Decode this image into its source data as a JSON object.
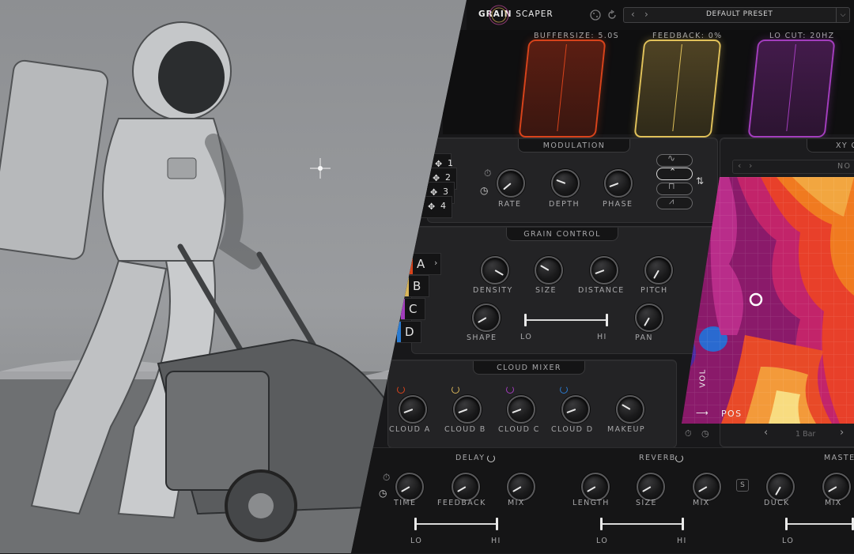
{
  "header": {
    "logo_part1": "GRAIN",
    "logo_part2": "SCAPER",
    "preset": "DEFAULT PRESET"
  },
  "grains": [
    {
      "label": "BUFFERSIZE: 5.0s",
      "color": "#d8431b"
    },
    {
      "label": "FEEDBACK: 0%",
      "color": "#e0c15a"
    },
    {
      "label": "LO CUT: 20hz",
      "color": "#a33dbd"
    }
  ],
  "modulation": {
    "title": "MODULATION",
    "slots": [
      "1",
      "2",
      "3",
      "4"
    ],
    "knobs": [
      "RATE",
      "DEPTH",
      "PHASE"
    ]
  },
  "grain_control": {
    "title": "GRAIN CONTROL",
    "slots": [
      {
        "label": "A",
        "color": "#d8431b"
      },
      {
        "label": "B",
        "color": "#d9b65a"
      },
      {
        "label": "C",
        "color": "#a33dbd"
      },
      {
        "label": "D",
        "color": "#2a7bd1"
      }
    ],
    "knobs_row1": [
      "DENSITY",
      "SIZE",
      "DISTANCE",
      "PITCH"
    ],
    "knobs_row2": [
      "SHAPE",
      "PAN"
    ],
    "range_lo": "LO",
    "range_hi": "HI"
  },
  "xy": {
    "title": "XY C",
    "preset": "NO P",
    "x_label": "POS",
    "y_label": "VOL",
    "sync": "1 Bar"
  },
  "cloud_mixer": {
    "title": "CLOUD MIXER",
    "knobs": [
      "CLOUD A",
      "CLOUD B",
      "CLOUD C",
      "CLOUD D",
      "MAKEUP"
    ],
    "power_colors": [
      "#d8431b",
      "#d9b65a",
      "#a33dbd",
      "#2a7bd1"
    ]
  },
  "delay": {
    "title": "DELAY",
    "knobs": [
      "TIME",
      "FEEDBACK",
      "MIX"
    ],
    "lo": "LO",
    "hi": "HI"
  },
  "reverb": {
    "title": "REVERB",
    "knobs": [
      "LENGTH",
      "SIZE",
      "MIX"
    ],
    "lo": "LO",
    "hi": "HI",
    "s_label": "S"
  },
  "master": {
    "title": "MASTE",
    "knobs": [
      "DUCK",
      "MIX"
    ],
    "lo": "LO"
  }
}
